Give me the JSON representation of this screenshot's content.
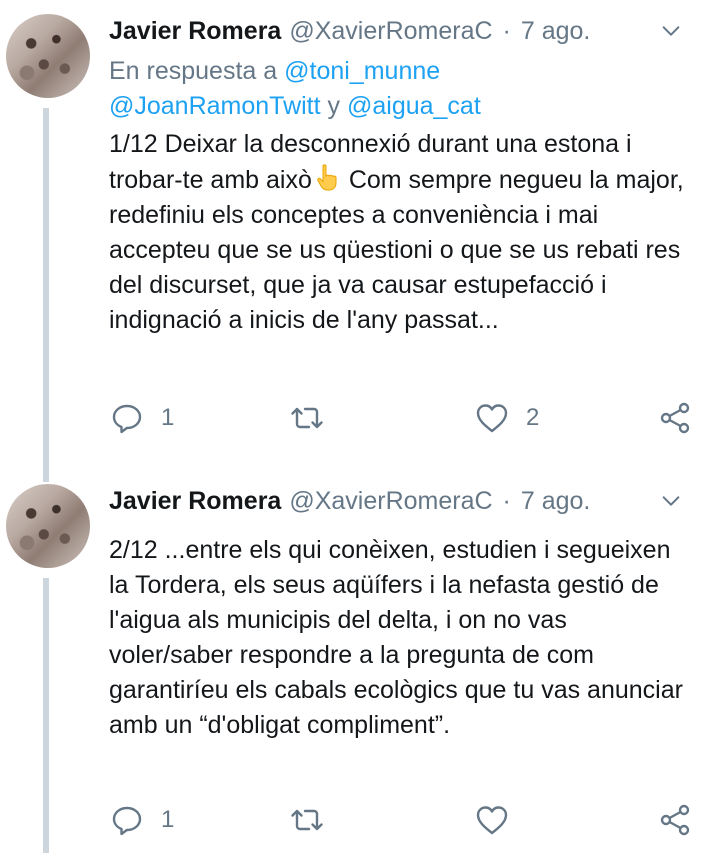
{
  "tweets": [
    {
      "author_name": "Javier Romera",
      "handle": "@XavierRomeraC",
      "separator": "·",
      "time": "7 ago.",
      "reply_to": {
        "prefix": "En respuesta a ",
        "mention_1": "@toni_munne",
        "mention_2": "@JoanRamonTwitt",
        "joiner": " y ",
        "mention_3": "@aigua_cat"
      },
      "text_before_emoji": "1/12 Deixar la desconnexió durant una estona i trobar-te amb això",
      "emoji": "backhand-index-pointing-up",
      "text_after_emoji": " Com sempre negueu la major, redefiniu els conceptes a conveniència i mai accepteu que se us qüestioni o que se us rebati res del discurset, que ja va causar estupefacció i indignació a inicis de l'any passat...",
      "replies": "1",
      "retweets": "",
      "likes": "2"
    },
    {
      "author_name": "Javier Romera",
      "handle": "@XavierRomeraC",
      "separator": "·",
      "time": "7 ago.",
      "text": "2/12 ...entre els qui conèixen, estudien i segueixen la Tordera, els seus aqüífers i la nefasta gestió de l'aigua als municipis del delta, i on no vas voler/saber respondre a la pregunta de com garantiríeu els cabals ecològics que tu vas anunciar amb un “d'obligat compliment”.",
      "replies": "1",
      "retweets": "",
      "likes": ""
    }
  ],
  "colors": {
    "text": "#14171a",
    "secondary": "#657786",
    "link": "#1da1f2",
    "thread_line": "#cdd6dd"
  },
  "icons": [
    "chevron-down-icon",
    "reply-icon",
    "retweet-icon",
    "like-icon",
    "share-icon"
  ]
}
